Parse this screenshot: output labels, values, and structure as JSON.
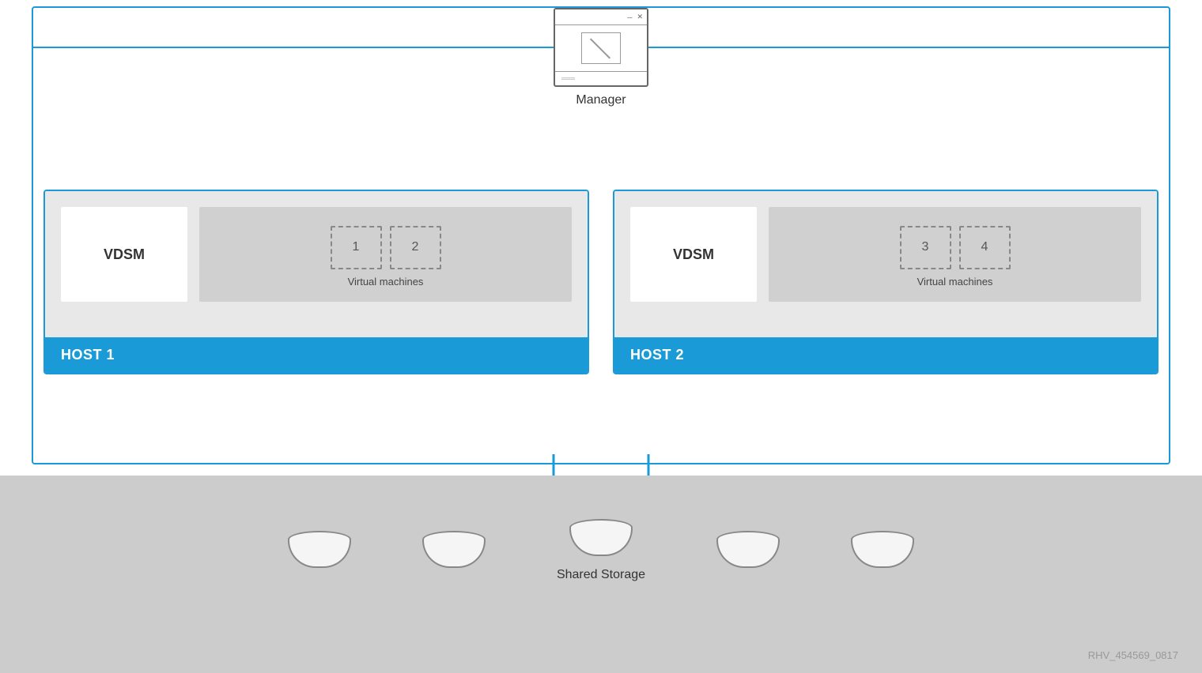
{
  "manager": {
    "label": "Manager"
  },
  "host1": {
    "vdsm_label": "VDSM",
    "vm_label": "Virtual machines",
    "vm1": "1",
    "vm2": "2",
    "footer_label": "HOST 1"
  },
  "host2": {
    "vdsm_label": "VDSM",
    "vm_label": "Virtual machines",
    "vm3": "3",
    "vm4": "4",
    "footer_label": "HOST 2"
  },
  "storage": {
    "label": "Shared Storage"
  },
  "watermark": {
    "text": "RHV_454569_0817"
  }
}
